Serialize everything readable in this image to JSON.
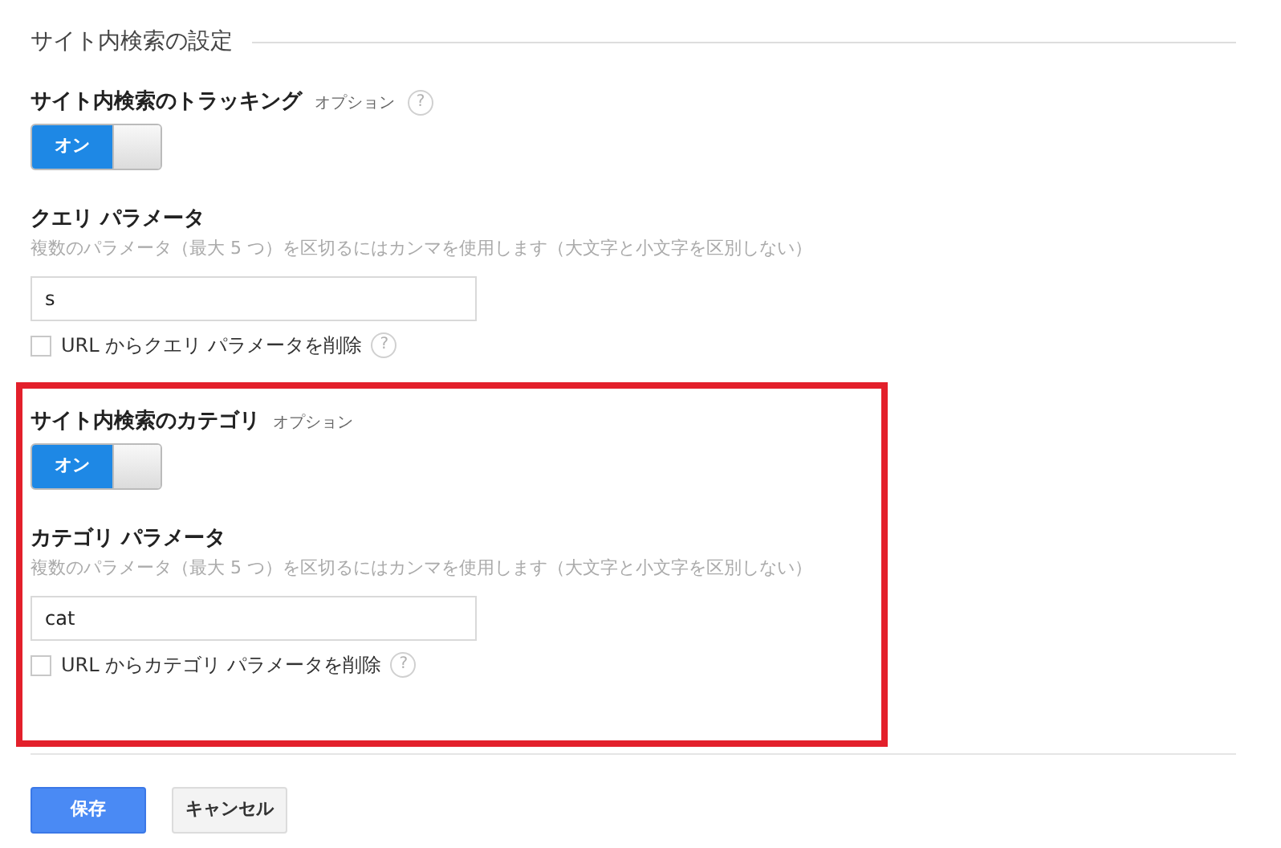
{
  "heading": "サイト内検索の設定",
  "sections": [
    {
      "title": "サイト内検索のトラッキング",
      "option_label": "オプション",
      "title_help": "?",
      "highlighted": false,
      "toggle": {
        "label": "オン",
        "on": true
      },
      "param": {
        "title": "クエリ パラメータ",
        "hint": "複数のパラメータ（最大 5 つ）を区切るにはカンマを使用します（大文字と小文字を区別しない）",
        "value": "s"
      },
      "checkbox": {
        "label": "URL からクエリ パラメータを削除",
        "checked": false,
        "help": "?"
      }
    },
    {
      "title": "サイト内検索のカテゴリ",
      "option_label": "オプション",
      "highlighted": true,
      "toggle": {
        "label": "オン",
        "on": true
      },
      "param": {
        "title": "カテゴリ パラメータ",
        "hint": "複数のパラメータ（最大 5 つ）を区切るにはカンマを使用します（大文字と小文字を区別しない）",
        "value": "cat"
      },
      "checkbox": {
        "label": "URL からカテゴリ パラメータを削除",
        "checked": false,
        "help": "?"
      }
    }
  ],
  "buttons": {
    "save": "保存",
    "cancel": "キャンセル"
  }
}
